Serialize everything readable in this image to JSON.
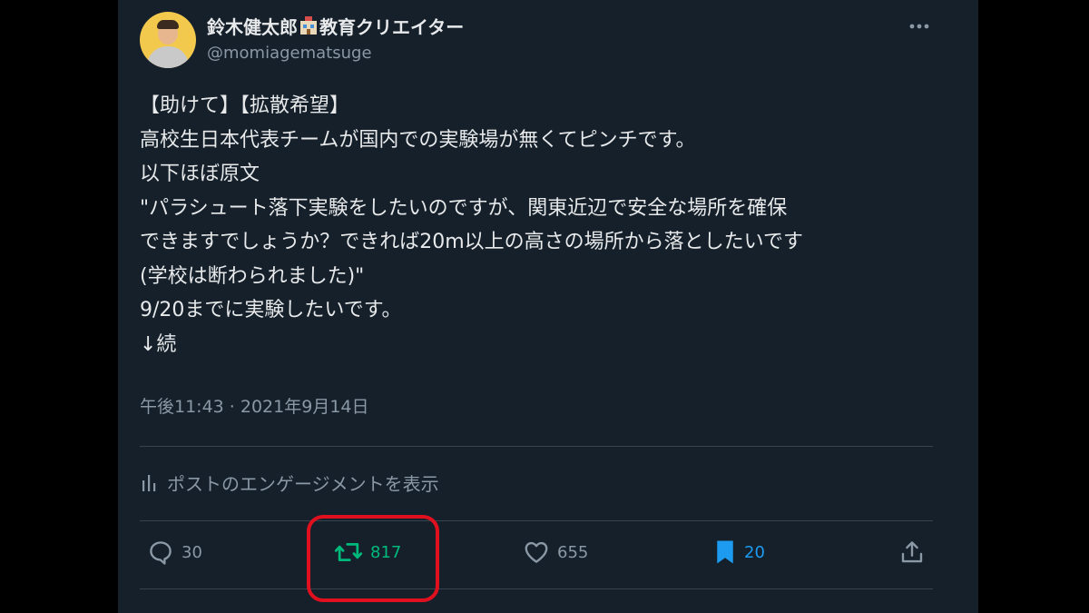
{
  "author": {
    "display_name_part1": "鈴木健太郎",
    "display_name_emoji": "school-emoji",
    "display_name_part2": "教育クリエイター",
    "handle": "@momiagematsuge"
  },
  "tweet": {
    "lines": [
      "【助けて】【拡散希望】",
      "高校生日本代表チームが国内での実験場が無くてピンチです。",
      "以下ほぼ原文",
      "\"パラシュート落下実験をしたいのですが、関東近辺で安全な場所を確保",
      "できますでしょうか？できれば20m以上の高さの場所から落としたいです",
      "(学校は断わられました)\"",
      "9/20までに実験したいです。",
      "↓続"
    ],
    "timestamp": "午後11:43 · 2021年9月14日"
  },
  "engagement_link": "ポストのエンゲージメントを表示",
  "actions": {
    "reply": {
      "count": "30",
      "icon": "reply-icon"
    },
    "repost": {
      "count": "817",
      "icon": "repost-icon",
      "color": "#00ba7c"
    },
    "like": {
      "count": "655",
      "icon": "heart-icon"
    },
    "bookmark": {
      "count": "20",
      "icon": "bookmark-icon",
      "color": "#1d9bf0"
    },
    "share": {
      "icon": "share-icon"
    }
  },
  "colors": {
    "background": "#15202b",
    "secondary_text": "#8b98a5",
    "highlight": "#e0101f"
  }
}
